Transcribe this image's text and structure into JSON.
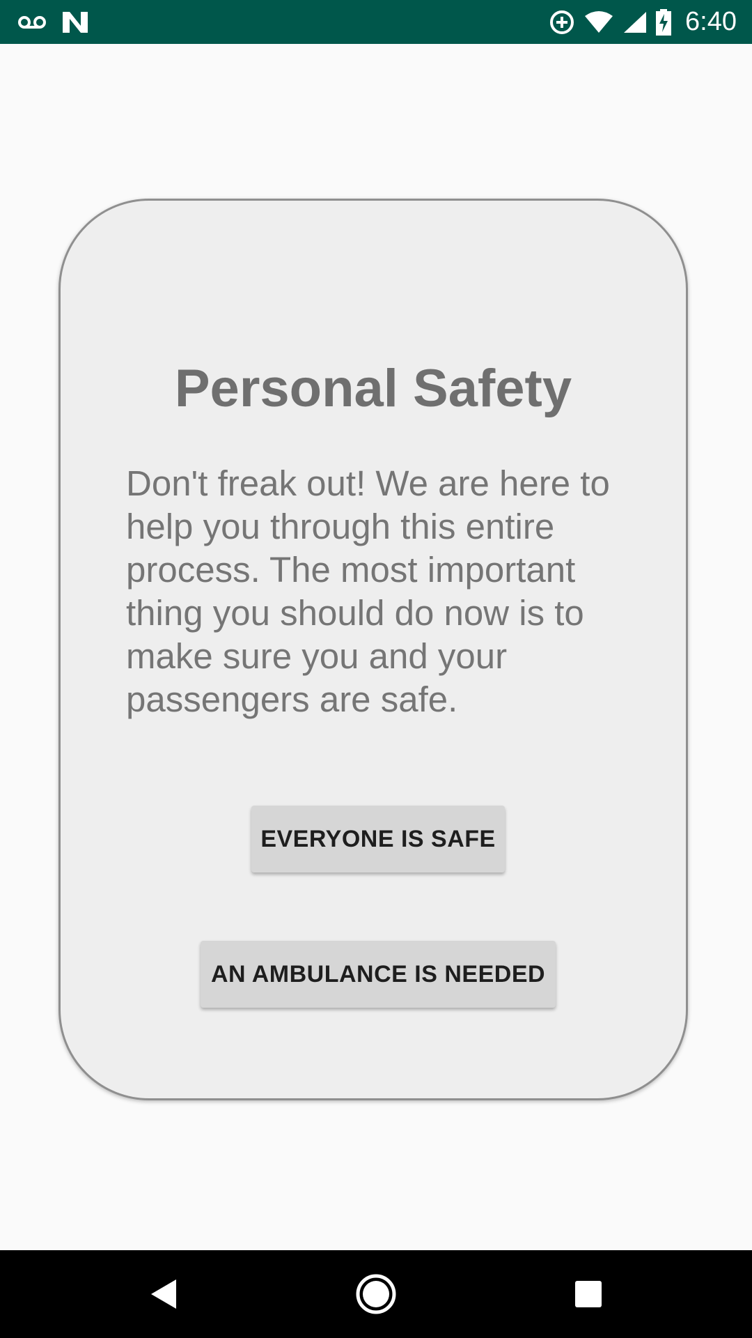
{
  "status_bar": {
    "time": "6:40",
    "left_icons": [
      "voicemail-icon",
      "n-logo-icon"
    ],
    "right_icons": [
      "data-saver-icon",
      "wifi-icon",
      "cell-signal-icon",
      "battery-charging-icon"
    ],
    "background_color": "#00574b"
  },
  "card": {
    "title": "Personal Safety",
    "body": "Don't freak out! We are here to help you through this entire process. The most important thing you should do now is to make sure you and your passengers are safe.",
    "buttons": {
      "safe_label": "EVERYONE IS SAFE",
      "ambulance_label": "AN AMBULANCE IS NEEDED"
    }
  },
  "nav_bar": {
    "icons": [
      "back-icon",
      "home-icon",
      "recents-icon"
    ]
  }
}
